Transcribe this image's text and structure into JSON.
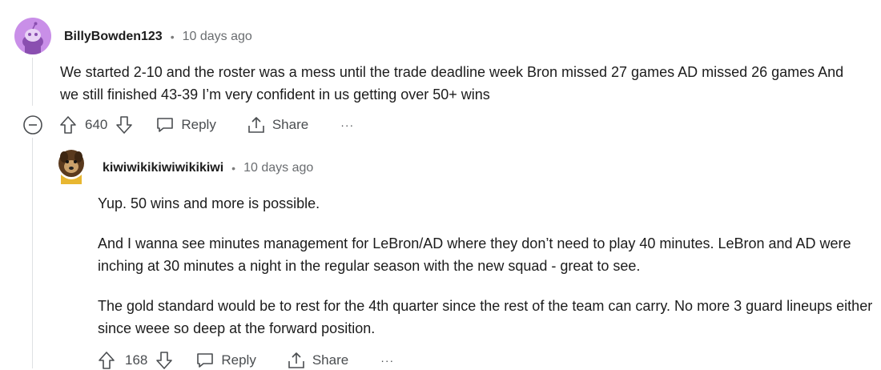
{
  "comments": [
    {
      "username": "BillyBowden123",
      "separator": "•",
      "time": "10 days ago",
      "body": [
        "We started 2-10 and the roster was a mess until the trade deadline week Bron missed 27 games AD missed 26 games And we still finished 43-39 I’m very confident in us getting over 50+ wins"
      ],
      "votes": "640",
      "reply_label": "Reply",
      "share_label": "Share",
      "more_label": "···",
      "avatar_color": "#c98fe8"
    },
    {
      "username": "kiwiwikikiwiwikikiwi",
      "separator": "•",
      "time": "10 days ago",
      "body": [
        "Yup. 50 wins and more is possible.",
        "And I wanna see minutes management for LeBron/AD where they don’t need to play 40 minutes. LeBron and AD were inching at 30 minutes a night in the regular season with the new squad - great to see.",
        "The gold standard would be to rest for the 4th quarter since the rest of the team can carry. No more 3 guard lineups either since weee so deep at the forward position."
      ],
      "votes": "168",
      "reply_label": "Reply",
      "share_label": "Share",
      "more_label": "···"
    }
  ],
  "icons": {
    "collapse": "collapse-minus-icon",
    "upvote": "upvote-arrow-icon",
    "downvote": "downvote-arrow-icon",
    "reply": "speech-bubble-icon",
    "share": "share-upload-icon",
    "more": "more-dots-icon"
  }
}
